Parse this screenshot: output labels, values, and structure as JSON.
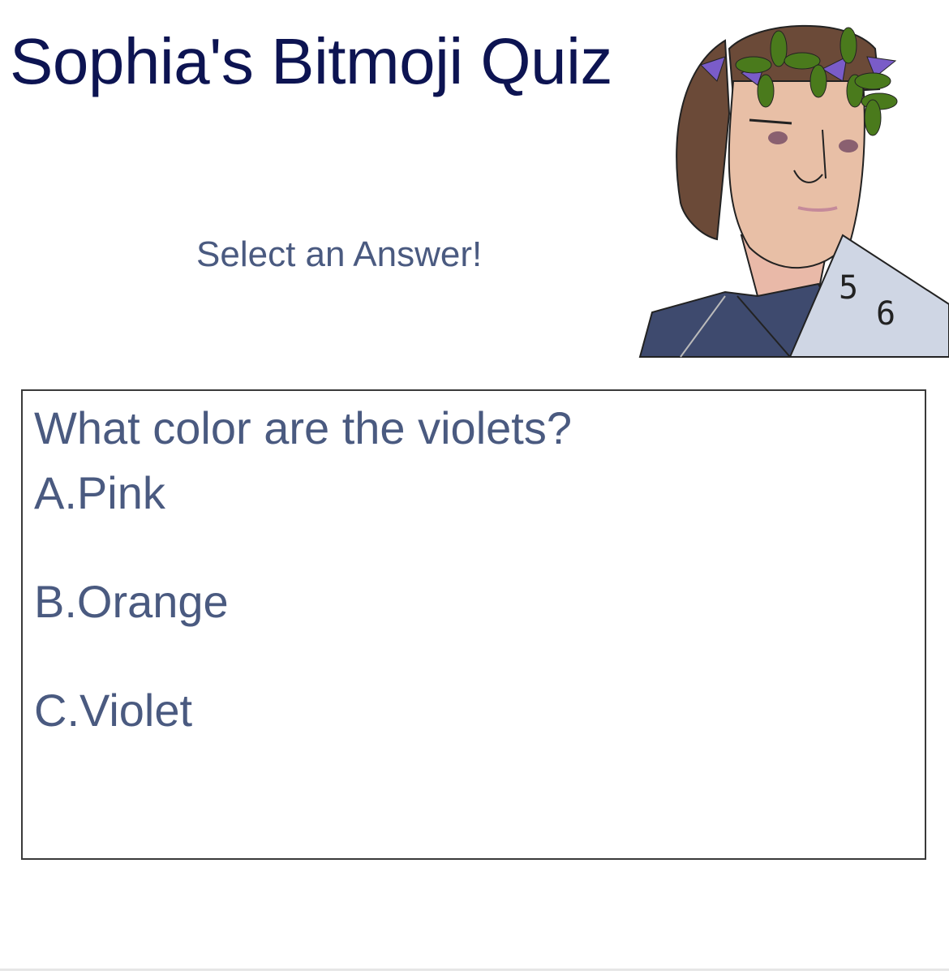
{
  "header": {
    "title": "Sophia's Bitmoji Quiz",
    "instruction": "Select an Answer!"
  },
  "quiz": {
    "question": "What color are the violets?",
    "answers": [
      {
        "label": "A.Pink"
      },
      {
        "label": "B.Orange"
      },
      {
        "label": "C.Violet"
      }
    ]
  },
  "avatar": {
    "icon": "bitmoji-avatar-icon",
    "shirt_text": [
      "5",
      "6"
    ]
  },
  "colors": {
    "title": "#0d1452",
    "text": "#4a5a80",
    "border": "#3a3a3a",
    "hair": "#6b4a38",
    "skin": "#e8bfa6",
    "shirt_dark": "#3e4a6e",
    "shirt_light": "#cfd6e4",
    "leaf": "#4a7a1c",
    "flower": "#7a5cc8"
  }
}
